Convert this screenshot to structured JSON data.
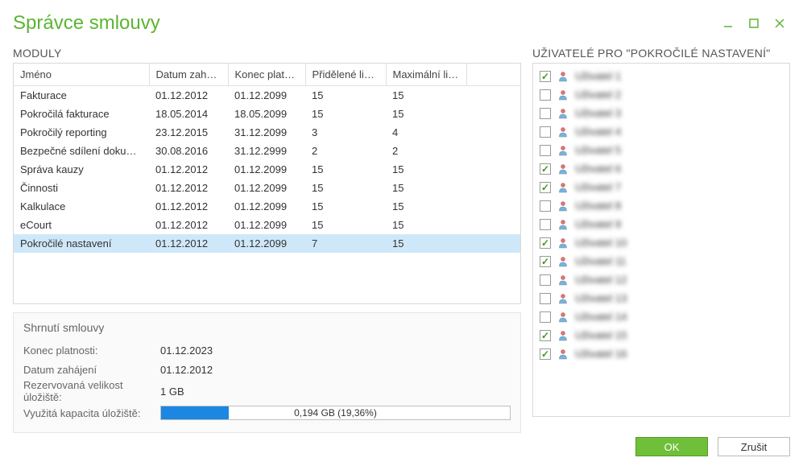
{
  "window": {
    "title": "Správce smlouvy"
  },
  "sections": {
    "modules_header": "MODULY",
    "users_header": "UŽIVATELÉ PRO \"POKROČILÉ NASTAVENÍ\"",
    "summary_title": "Shrnutí smlouvy"
  },
  "modules": {
    "columns": {
      "name": "Jméno",
      "start": "Datum zahájení",
      "end": "Konec platnosti",
      "assigned": "Přidělené licence",
      "max": "Maximální licence"
    },
    "rows": [
      {
        "name": "Fakturace",
        "start": "01.12.2012",
        "end": "01.12.2099",
        "assigned": "15",
        "max": "15",
        "selected": false
      },
      {
        "name": "Pokročilá fakturace",
        "start": "18.05.2014",
        "end": "18.05.2099",
        "assigned": "15",
        "max": "15",
        "selected": false
      },
      {
        "name": "Pokročilý reporting",
        "start": "23.12.2015",
        "end": "31.12.2099",
        "assigned": "3",
        "max": "4",
        "selected": false
      },
      {
        "name": "Bezpečné sdílení dokumentů",
        "start": "30.08.2016",
        "end": "31.12.2999",
        "assigned": "2",
        "max": "2",
        "selected": false
      },
      {
        "name": "Správa kauzy",
        "start": "01.12.2012",
        "end": "01.12.2099",
        "assigned": "15",
        "max": "15",
        "selected": false
      },
      {
        "name": "Činnosti",
        "start": "01.12.2012",
        "end": "01.12.2099",
        "assigned": "15",
        "max": "15",
        "selected": false
      },
      {
        "name": "Kalkulace",
        "start": "01.12.2012",
        "end": "01.12.2099",
        "assigned": "15",
        "max": "15",
        "selected": false
      },
      {
        "name": "eCourt",
        "start": "01.12.2012",
        "end": "01.12.2099",
        "assigned": "15",
        "max": "15",
        "selected": false
      },
      {
        "name": "Pokročilé nastavení",
        "start": "01.12.2012",
        "end": "01.12.2099",
        "assigned": "7",
        "max": "15",
        "selected": true
      }
    ]
  },
  "summary": {
    "end_label": "Konec platnosti:",
    "end_value": "01.12.2023",
    "start_label": "Datum zahájení",
    "start_value": "01.12.2012",
    "storage_reserved_label": "Rezervovaná velikost úložiště:",
    "storage_reserved_value": "1 GB",
    "storage_used_label": "Využitá kapacita úložiště:",
    "storage_used_text": "0,194 GB (19,36%)",
    "storage_used_percent": 19.36
  },
  "users": [
    {
      "checked": true,
      "name": "Uživatel 1"
    },
    {
      "checked": false,
      "name": "Uživatel 2"
    },
    {
      "checked": false,
      "name": "Uživatel 3"
    },
    {
      "checked": false,
      "name": "Uživatel 4"
    },
    {
      "checked": false,
      "name": "Uživatel 5"
    },
    {
      "checked": true,
      "name": "Uživatel 6"
    },
    {
      "checked": true,
      "name": "Uživatel 7"
    },
    {
      "checked": false,
      "name": "Uživatel 8"
    },
    {
      "checked": false,
      "name": "Uživatel 9"
    },
    {
      "checked": true,
      "name": "Uživatel 10"
    },
    {
      "checked": true,
      "name": "Uživatel 11"
    },
    {
      "checked": false,
      "name": "Uživatel 12"
    },
    {
      "checked": false,
      "name": "Uživatel 13"
    },
    {
      "checked": false,
      "name": "Uživatel 14"
    },
    {
      "checked": true,
      "name": "Uživatel 15"
    },
    {
      "checked": true,
      "name": "Uživatel 16"
    }
  ],
  "buttons": {
    "ok": "OK",
    "cancel": "Zrušit"
  }
}
